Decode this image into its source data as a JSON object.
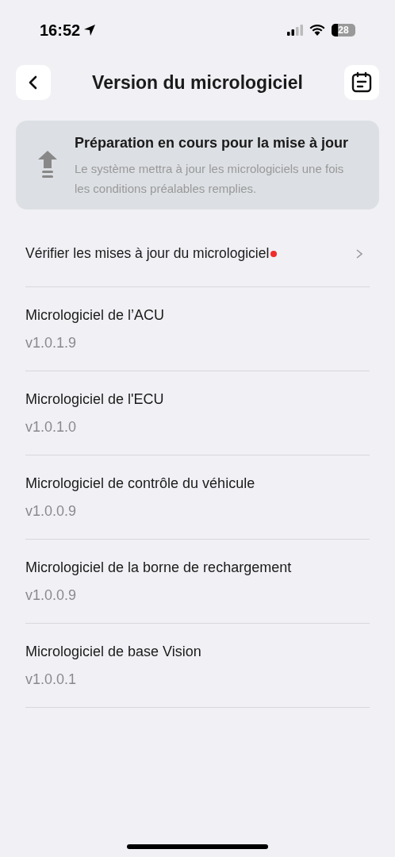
{
  "status_bar": {
    "time": "16:52",
    "battery": "28"
  },
  "nav": {
    "title": "Version du micrologiciel"
  },
  "banner": {
    "title": "Préparation en cours pour la mise à jour",
    "text": "Le système mettra à jour les micrologiciels une fois les conditions préalables remplies."
  },
  "check_updates": {
    "label": "Vérifier les mises à jour du micrologiciel",
    "has_update": true
  },
  "firmware": [
    {
      "name": "Micrologiciel de l’ACU",
      "version": "v1.0.1.9"
    },
    {
      "name": "Micrologiciel de l'ECU",
      "version": "v1.0.1.0"
    },
    {
      "name": "Micrologiciel de contrôle du véhicule",
      "version": "v1.0.0.9"
    },
    {
      "name": "Micrologiciel de la borne de rechargement",
      "version": "v1.0.0.9"
    },
    {
      "name": "Micrologiciel de base Vision",
      "version": "v1.0.0.1"
    }
  ]
}
